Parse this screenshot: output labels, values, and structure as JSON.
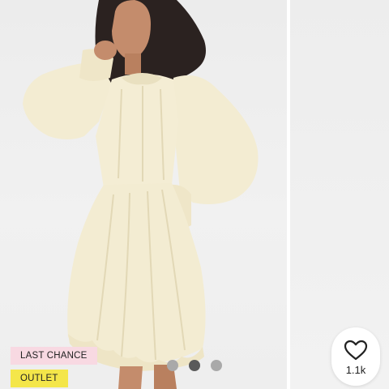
{
  "product_card": {
    "badges": {
      "last_chance": "LAST CHANCE",
      "outlet": "OUTLET"
    },
    "favorite": {
      "icon": "heart-outline-icon",
      "count": "1.1k"
    },
    "carousel": {
      "dots": 3,
      "active_index": 1
    },
    "image": "Model wearing a cream long-sleeve mini dress with ruffle hem"
  },
  "colors": {
    "badge_last_chance_bg": "#f8d9e2",
    "badge_outlet_bg": "#f4e64a",
    "dress": "#f3ecd2",
    "dot_active": "#5a5a5a",
    "dot_inactive": "#a9a9a9"
  }
}
